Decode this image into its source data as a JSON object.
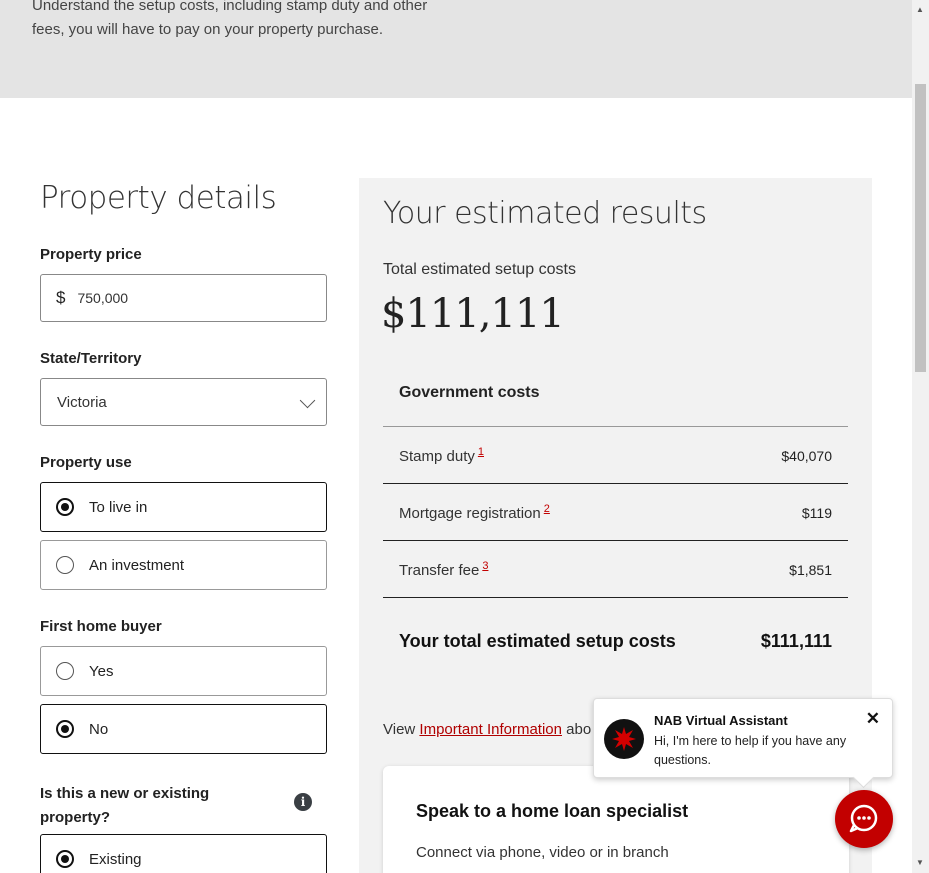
{
  "hero": {
    "description": "Understand the setup costs, including stamp duty and other fees, you will have to pay on your property purchase."
  },
  "form": {
    "title": "Property details",
    "price": {
      "label": "Property price",
      "prefix": "$",
      "value": "750,000"
    },
    "state": {
      "label": "State/Territory",
      "selected": "Victoria"
    },
    "use": {
      "label": "Property use",
      "options": [
        {
          "label": "To live in",
          "checked": true
        },
        {
          "label": "An investment",
          "checked": false
        }
      ]
    },
    "first_home": {
      "label": "First home buyer",
      "options": [
        {
          "label": "Yes",
          "checked": false
        },
        {
          "label": "No",
          "checked": true
        }
      ]
    },
    "new_existing": {
      "label": "Is this a new or existing property?",
      "options": [
        {
          "label": "Existing",
          "checked": true
        }
      ],
      "info_icon": "i"
    }
  },
  "results": {
    "title": "Your estimated results",
    "total_label": "Total estimated setup costs",
    "total_value": "$111,111",
    "gov_header": "Government costs",
    "rows": [
      {
        "label": "Stamp duty",
        "footnote": "1",
        "value": "$40,070"
      },
      {
        "label": "Mortgage registration",
        "footnote": "2",
        "value": "$119"
      },
      {
        "label": "Transfer fee",
        "footnote": "3",
        "value": "$1,851"
      }
    ],
    "grand_label": "Your total estimated setup costs",
    "grand_value": "$111,111",
    "view_prefix": "View ",
    "view_link": "Important Information",
    "view_suffix": " abo",
    "card": {
      "title": "Speak to a home loan specialist",
      "subtitle": "Connect via phone, video or in branch"
    }
  },
  "assistant": {
    "title": "NAB Virtual Assistant",
    "message": "Hi, I'm here to help if you have any questions.",
    "close": "✕",
    "logo_icon": "nab-star-icon",
    "chat_icon": "chat-bubble-icon",
    "accent": "#c20000"
  },
  "scrollbar": {
    "up": "▲",
    "down": "▼"
  }
}
